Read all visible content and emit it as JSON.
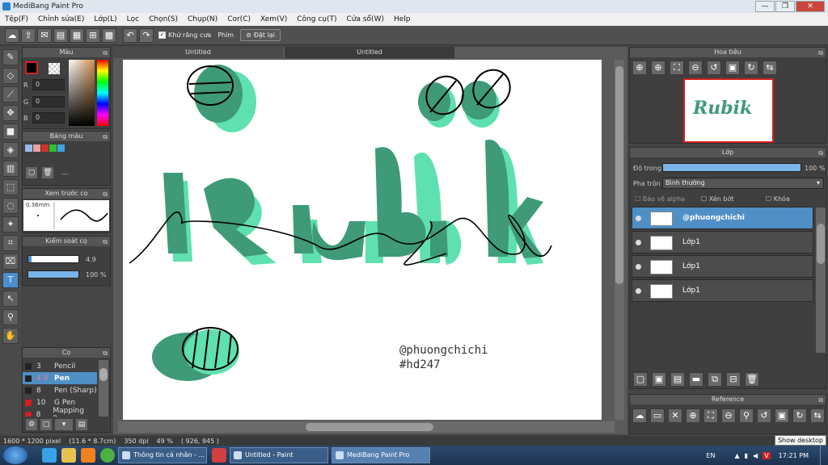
{
  "window": {
    "title": "MediBang Paint Pro",
    "btn_min": "—",
    "btn_max": "❐",
    "btn_close": "✕"
  },
  "menu": [
    "Tệp(F)",
    "Chỉnh sửa(E)",
    "Lớp(L)",
    "Lọc",
    "Chọn(S)",
    "Chụp(N)",
    "Cor(C)",
    "Xem(V)",
    "Công cụ(T)",
    "Cửa sổ(W)",
    "Help"
  ],
  "toolbar": {
    "antialias_label": "Khử răng cưa",
    "antialias_checked": "✓",
    "key_label": "Phím",
    "reset_label": "Đặt lại"
  },
  "color_panel": {
    "title": "Màu",
    "r_label": "R",
    "r": "0",
    "g_label": "G",
    "g": "0",
    "b_label": "B",
    "b": "0"
  },
  "palette_panel": {
    "title": "Bảng màu",
    "dash": "---",
    "swatches": [
      "#9ab8e8",
      "#e8a0a0",
      "#d03030",
      "#30c030",
      "#40a0e0"
    ]
  },
  "preview_panel": {
    "title": "Xem trước cọ",
    "size": "0.36mm"
  },
  "brush_ctrl_panel": {
    "title": "Kiểm soát cọ",
    "size": "4.9",
    "opacity": "100 %"
  },
  "brush_panel": {
    "title": "Cọ",
    "items": [
      {
        "n": "3",
        "name": "Pencil"
      },
      {
        "n": "4.9",
        "name": "Pen"
      },
      {
        "n": "8",
        "name": "Pen (Sharp)"
      },
      {
        "n": "10",
        "name": "G Pen"
      },
      {
        "n": "8",
        "name": "Mapping Pen"
      }
    ]
  },
  "tabs": [
    "Untitled",
    "Untitled"
  ],
  "canvas": {
    "handle": "@phuongchichi",
    "hashtag": "#hd247",
    "title_text": "Rubik"
  },
  "navigator": {
    "title": "Hoa tiêu"
  },
  "layer_panel": {
    "title": "Lớp",
    "opacity_label": "Độ trong",
    "opacity_value": "100 %",
    "blend_label": "Pha trộn",
    "blend_value": "Bình thường",
    "protect_alpha": "Bảo vệ alpha",
    "clip": "Xén bớt",
    "lock": "Khóa"
  },
  "layers": [
    "@phuongchichi",
    "Lớp1",
    "Lớp1",
    "Lớp1"
  ],
  "reference": {
    "title": "Reference"
  },
  "status": {
    "size": "1600 * 1200 pixel",
    "cm": "(11.6 * 8.7cm)",
    "dpi": "350 dpi",
    "zoom": "49 %",
    "coord": "( 926, 945 )"
  },
  "taskbar": {
    "tasks": [
      "Thông tin cá nhân - ...",
      "Untitled - Paint",
      "MediBang Paint Pro"
    ],
    "lang": "EN",
    "time": "17:21 PM",
    "tooltip": "Show desktop"
  }
}
